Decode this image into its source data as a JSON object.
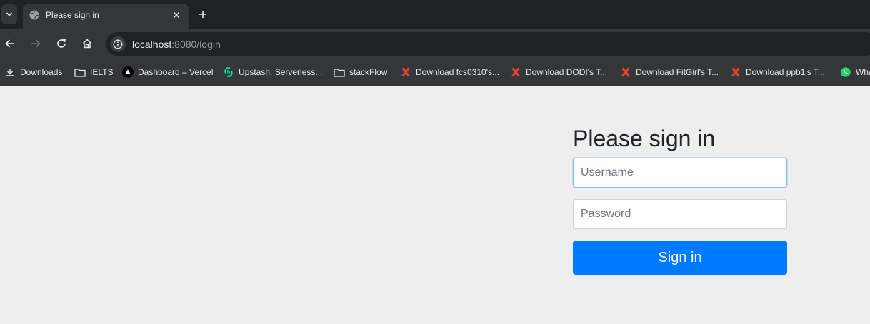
{
  "colors": {
    "tabstrip_bg": "#202124",
    "toolbar_bg": "#35363a",
    "page_bg": "#eeeeee",
    "primary_button": "#007bff",
    "focus_border": "#80bdff"
  },
  "browser": {
    "tab": {
      "title": "Please sign in",
      "favicon": "globe-icon"
    },
    "address": {
      "host": "localhost",
      "path": ":8080/login"
    },
    "bookmarks": [
      {
        "label": "Downloads",
        "icon": "download-icon"
      },
      {
        "label": "IELTS",
        "icon": "folder-icon"
      },
      {
        "label": "Dashboard – Vercel",
        "icon": "vercel-icon"
      },
      {
        "label": "Upstash: Serverless...",
        "icon": "upstash-icon"
      },
      {
        "label": "stackFlow",
        "icon": "folder-icon"
      },
      {
        "label": "Download fcs0310's...",
        "icon": "x-logo-icon"
      },
      {
        "label": "Download DODI's T...",
        "icon": "x-logo-icon"
      },
      {
        "label": "Download FitGirl's T...",
        "icon": "x-logo-icon"
      },
      {
        "label": "Download ppb1's T...",
        "icon": "x-logo-icon"
      },
      {
        "label": "Wha",
        "icon": "whatsapp-icon"
      }
    ]
  },
  "login": {
    "heading": "Please sign in",
    "username_placeholder": "Username",
    "username_value": "",
    "password_placeholder": "Password",
    "password_value": "",
    "submit_label": "Sign in"
  }
}
